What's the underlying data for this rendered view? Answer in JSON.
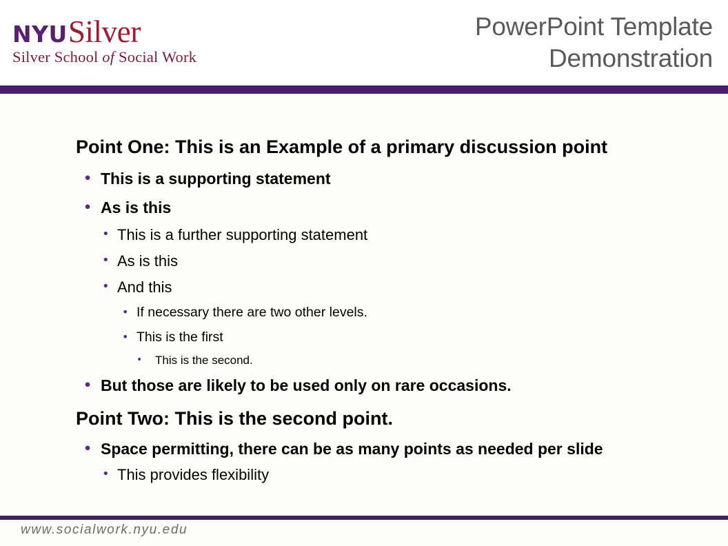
{
  "brand": {
    "logo": {
      "nyu": "NYU",
      "silver": "Silver",
      "tagline_before": "Silver School ",
      "tagline_italic": "of",
      "tagline_after": " Social Work",
      "nyu_color": "#5b1f72",
      "silver_color": "#9e1b32",
      "tagline_color": "#7d1d35"
    },
    "accent_bar_color": "#481d6f",
    "footer_rule_color": "#3d2259",
    "bullet_color": "#5b2d82",
    "title_color": "#595959",
    "background_color": "#fdfdfb"
  },
  "header": {
    "title_line1": "PowerPoint Template",
    "title_line2": "Demonstration"
  },
  "content": {
    "items": [
      {
        "level": 1,
        "text": "Point One: This is an Example of a primary discussion point",
        "bullet": ""
      },
      {
        "level": 2,
        "text": "This is a supporting statement",
        "bullet": "•"
      },
      {
        "level": 2,
        "text": "As is this",
        "bullet": "•"
      },
      {
        "level": 3,
        "text": "This is a further supporting statement",
        "bullet": "•"
      },
      {
        "level": 3,
        "text": "As is this",
        "bullet": "•"
      },
      {
        "level": 3,
        "text": "And this",
        "bullet": "•"
      },
      {
        "level": 4,
        "text": "If necessary there are two other levels.",
        "bullet": "•"
      },
      {
        "level": 4,
        "text": "This is the first",
        "bullet": "•"
      },
      {
        "level": 5,
        "text": "This is the second.",
        "bullet": "•"
      },
      {
        "level": 2,
        "text": "But those are likely to be used only on rare occasions.",
        "bullet": "•"
      },
      {
        "level": 1,
        "text": "Point Two: This is the second point.",
        "bullet": ""
      },
      {
        "level": 2,
        "text": "Space permitting, there can be as many points as needed per slide",
        "bullet": "•"
      },
      {
        "level": 3,
        "text": "This provides flexibility",
        "bullet": "•"
      }
    ]
  },
  "footer": {
    "url": "www.socialwork.nyu.edu"
  }
}
